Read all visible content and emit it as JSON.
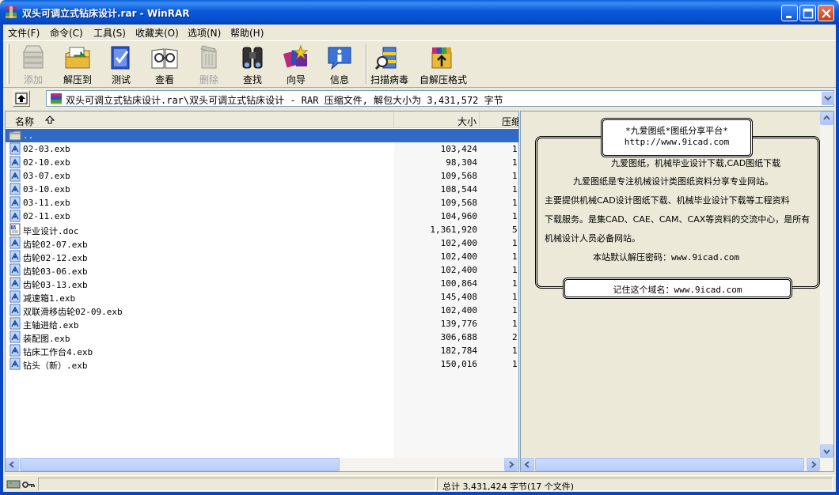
{
  "window": {
    "title": "双头可调立式钻床设计.rar - WinRAR"
  },
  "menu": [
    {
      "label": "文件(F)"
    },
    {
      "label": "命令(C)"
    },
    {
      "label": "工具(S)"
    },
    {
      "label": "收藏夹(O)"
    },
    {
      "label": "选项(N)"
    },
    {
      "label": "帮助(H)"
    }
  ],
  "toolbar": [
    {
      "label": "添加",
      "icon": "add-icon",
      "enabled": false
    },
    {
      "label": "解压到",
      "icon": "extract-to-icon",
      "enabled": true
    },
    {
      "label": "测试",
      "icon": "test-icon",
      "enabled": true
    },
    {
      "label": "查看",
      "icon": "view-icon",
      "enabled": true
    },
    {
      "label": "删除",
      "icon": "delete-icon",
      "enabled": false
    },
    {
      "label": "查找",
      "icon": "find-icon",
      "enabled": true
    },
    {
      "label": "向导",
      "icon": "wizard-icon",
      "enabled": true
    },
    {
      "label": "信息",
      "icon": "info-icon",
      "enabled": true
    },
    {
      "label": "扫描病毒",
      "icon": "virus-scan-icon",
      "enabled": true
    },
    {
      "label": "自解压格式",
      "icon": "sfx-icon",
      "enabled": true
    }
  ],
  "address": {
    "path": "双头可调立式钻床设计.rar\\双头可调立式钻床设计 - RAR 压缩文件, 解包大小为 3,431,572 字节"
  },
  "columns": {
    "name": "名称",
    "size": "大小",
    "packed": "压缩"
  },
  "files": [
    {
      "name": "..",
      "size": "",
      "packed": "",
      "type": "folder",
      "selected": true
    },
    {
      "name": "02-03.exb",
      "size": "103,424",
      "packed": "1",
      "type": "exb"
    },
    {
      "name": "02-10.exb",
      "size": "98,304",
      "packed": "1",
      "type": "exb"
    },
    {
      "name": "03-07.exb",
      "size": "109,568",
      "packed": "1",
      "type": "exb"
    },
    {
      "name": "03-10.exb",
      "size": "108,544",
      "packed": "1",
      "type": "exb"
    },
    {
      "name": "03-11.exb",
      "size": "109,568",
      "packed": "1",
      "type": "exb"
    },
    {
      "name": "02-11.exb",
      "size": "104,960",
      "packed": "1",
      "type": "exb"
    },
    {
      "name": "毕业设计.doc",
      "size": "1,361,920",
      "packed": "5",
      "type": "doc"
    },
    {
      "name": "齿轮02-07.exb",
      "size": "102,400",
      "packed": "1",
      "type": "exb"
    },
    {
      "name": "齿轮02-12.exb",
      "size": "102,400",
      "packed": "1",
      "type": "exb"
    },
    {
      "name": "齿轮03-06.exb",
      "size": "102,400",
      "packed": "1",
      "type": "exb"
    },
    {
      "name": "齿轮03-13.exb",
      "size": "100,864",
      "packed": "1",
      "type": "exb"
    },
    {
      "name": "减速箱1.exb",
      "size": "145,408",
      "packed": "1",
      "type": "exb"
    },
    {
      "name": "双联滑移齿轮02-09.exb",
      "size": "102,400",
      "packed": "1",
      "type": "exb"
    },
    {
      "name": "主轴进给.exb",
      "size": "139,776",
      "packed": "1",
      "type": "exb"
    },
    {
      "name": "装配图.exb",
      "size": "306,688",
      "packed": "2",
      "type": "exb"
    },
    {
      "name": "钻床工作台4.exb",
      "size": "182,784",
      "packed": "1",
      "type": "exb"
    },
    {
      "name": "钻头（新）.exb",
      "size": "150,016",
      "packed": "1",
      "type": "exb"
    }
  ],
  "comment": {
    "header_title": "*九爱图纸*图纸分享平台*",
    "header_url": "http://www.9icad.com",
    "lines": [
      "九爱图纸，机械毕业设计下载,CAD图纸下载",
      "九爱图纸是专注机械设计类图纸资料分享专业网站。",
      "主要提供机械CAD设计图纸下载、机械毕业设计下载等工程资料",
      "下载服务。是集CAD、CAE、CAM、CAX等资料的交流中心，是所有",
      "机械设计人员必备网站。",
      "本站默认解压密码：www.9icad.com"
    ],
    "footer": "记住这个域名：www.9icad.com"
  },
  "status": {
    "left": "",
    "right": "总计 3,431,424 字节(17 个文件)"
  },
  "colors": {
    "title_blue": "#0450d0",
    "selection": "#316ac5",
    "face": "#ece9d8"
  }
}
